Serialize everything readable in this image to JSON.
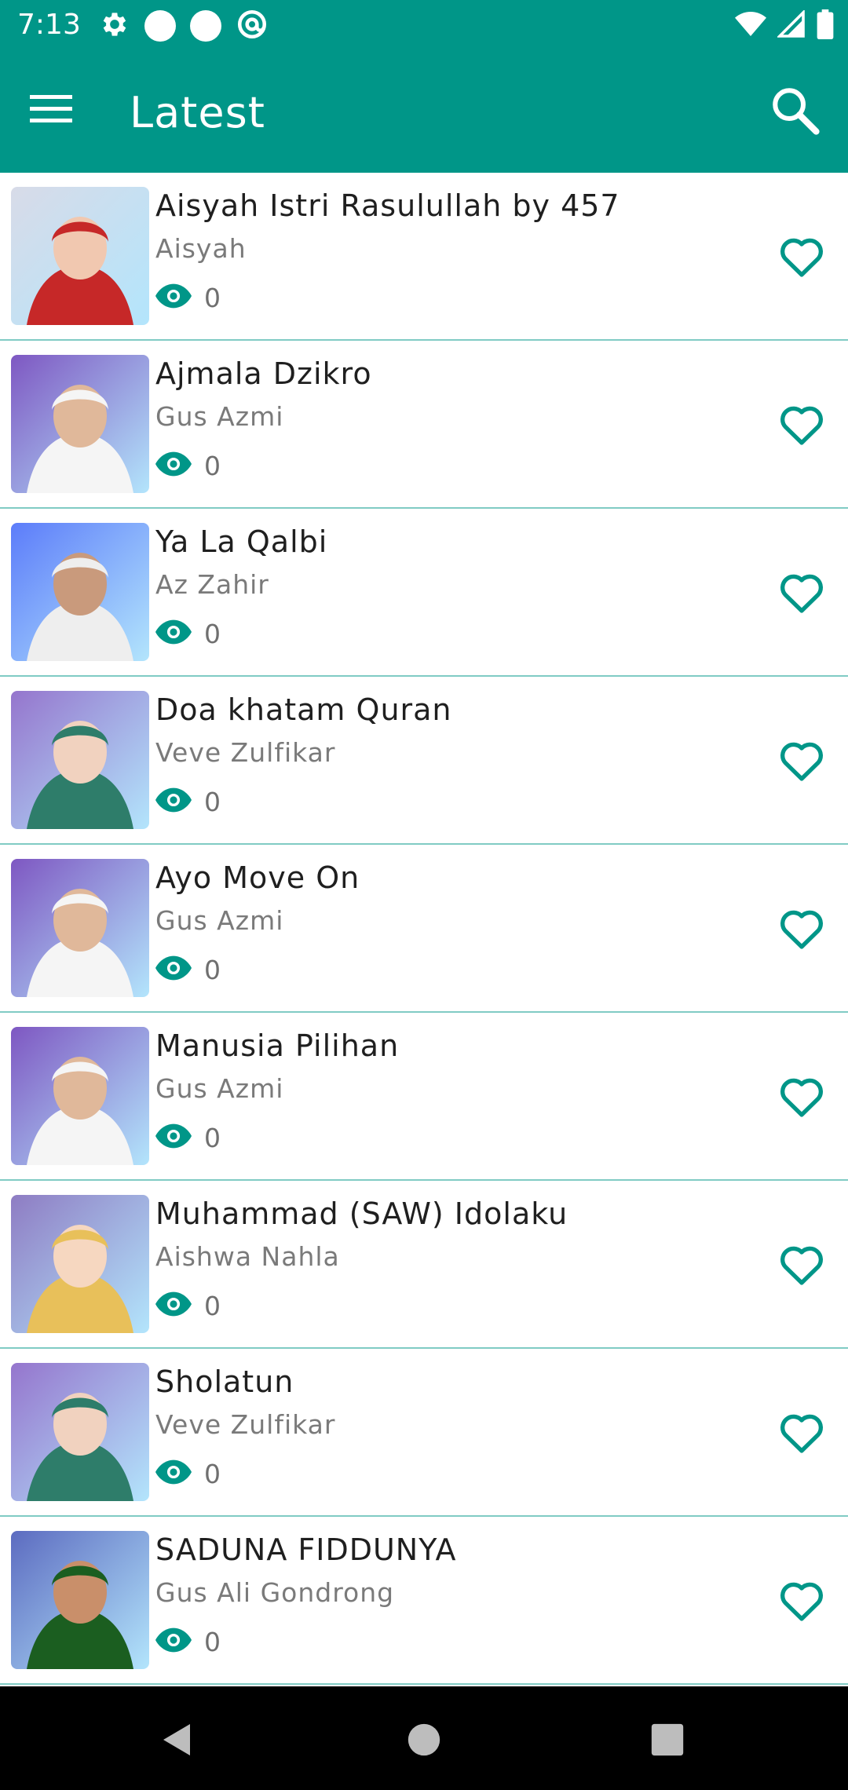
{
  "status_bar": {
    "time": "7:13",
    "left_icons": [
      "settings-icon",
      "circle-icon",
      "circle-icon",
      "at-sign-icon"
    ],
    "right_icons": [
      "wifi-icon",
      "signal-icon",
      "battery-icon"
    ]
  },
  "app_bar": {
    "title": "Latest",
    "menu_icon": "menu-icon",
    "search_icon": "search-icon",
    "color": "#009688"
  },
  "songs": [
    {
      "title": "Aisyah Istri Rasulullah by 457",
      "artist": "Aisyah",
      "views": "0"
    },
    {
      "title": "Ajmala Dzikro",
      "artist": "Gus Azmi",
      "views": "0"
    },
    {
      "title": "Ya La Qalbi",
      "artist": "Az Zahir",
      "views": "0"
    },
    {
      "title": "Doa khatam Quran",
      "artist": "Veve Zulfikar",
      "views": "0"
    },
    {
      "title": "Ayo Move On",
      "artist": "Gus Azmi",
      "views": "0"
    },
    {
      "title": "Manusia Pilihan",
      "artist": "Gus Azmi",
      "views": "0"
    },
    {
      "title": "Muhammad (SAW) Idolaku",
      "artist": "Aishwa Nahla",
      "views": "0"
    },
    {
      "title": "Sholatun",
      "artist": "Veve Zulfikar",
      "views": "0"
    },
    {
      "title": "SADUNA FIDDUNYA",
      "artist": "Gus Ali Gondrong",
      "views": "0"
    }
  ],
  "accent_color": "#009688",
  "nav_bar": {
    "buttons": [
      "back-icon",
      "home-icon",
      "recents-icon"
    ]
  }
}
